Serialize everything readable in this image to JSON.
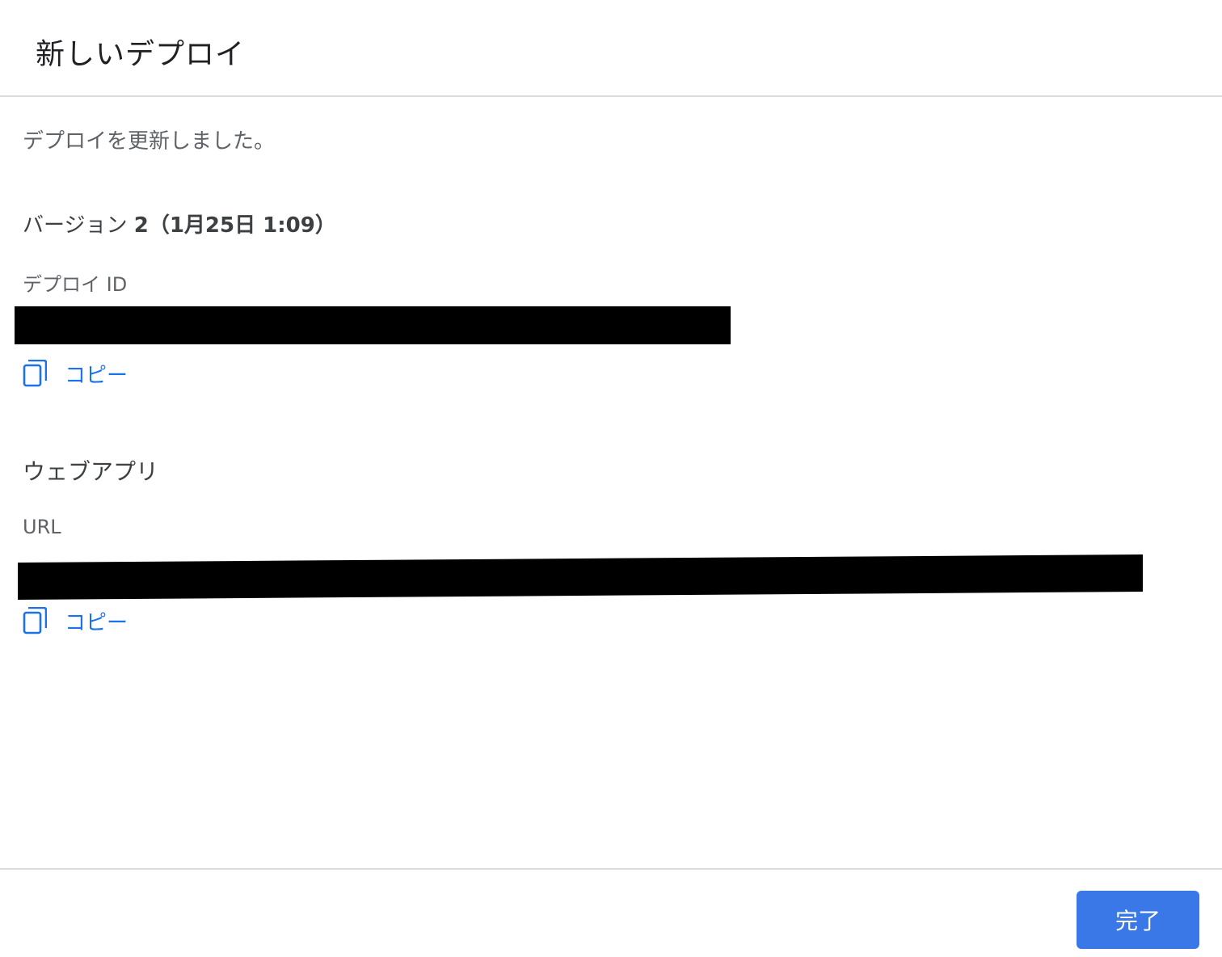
{
  "dialog": {
    "title": "新しいデプロイ",
    "message": "デプロイを更新しました。",
    "version": {
      "prefix": "バージョン ",
      "number": "2",
      "date": "（1月25日 1:09）"
    },
    "deploy_id": {
      "label": "デプロイ ID",
      "copy_label": "コピー"
    },
    "web_app": {
      "section_title": "ウェブアプリ",
      "url_label": "URL",
      "copy_label": "コピー"
    },
    "done_label": "完了"
  },
  "colors": {
    "accent": "#1a73e8",
    "primary_button": "#3b78e7",
    "divider": "#dadce0"
  },
  "icons": {
    "copy": "copy-icon"
  }
}
